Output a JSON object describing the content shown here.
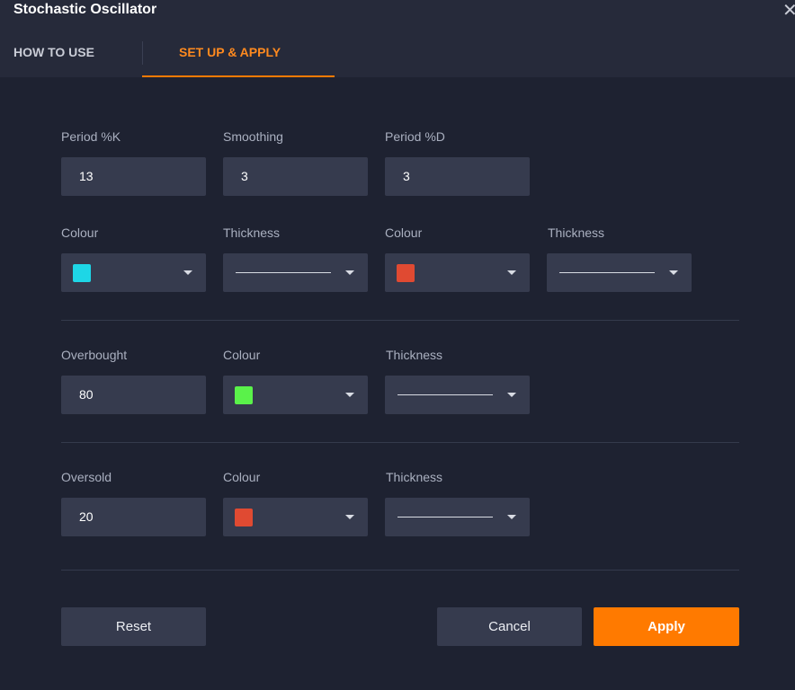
{
  "dialog": {
    "title": "Stochastic Oscillator",
    "close_glyph": "✕"
  },
  "tabs": [
    {
      "label": "HOW TO USE",
      "active": false
    },
    {
      "label": "SET UP & APPLY",
      "active": true
    }
  ],
  "colors": {
    "accent": "#ff7a00",
    "cyan": "#1ed6e6",
    "red": "#e04a32",
    "green": "#5af24a"
  },
  "k_section": {
    "period_k": {
      "label": "Period %K",
      "value": "13"
    },
    "smoothing": {
      "label": "Smoothing",
      "value": "3"
    },
    "period_d": {
      "label": "Period %D",
      "value": "3"
    },
    "k_colour": {
      "label": "Colour",
      "value": "#1ed6e6"
    },
    "k_thickness": {
      "label": "Thickness"
    },
    "d_colour": {
      "label": "Colour",
      "value": "#e04a32"
    },
    "d_thickness": {
      "label": "Thickness"
    }
  },
  "overbought": {
    "label": "Overbought",
    "value": "80",
    "colour_label": "Colour",
    "colour": "#5af24a",
    "thickness_label": "Thickness"
  },
  "oversold": {
    "label": "Oversold",
    "value": "20",
    "colour_label": "Colour",
    "colour": "#e04a32",
    "thickness_label": "Thickness"
  },
  "buttons": {
    "reset": "Reset",
    "cancel": "Cancel",
    "apply": "Apply"
  }
}
